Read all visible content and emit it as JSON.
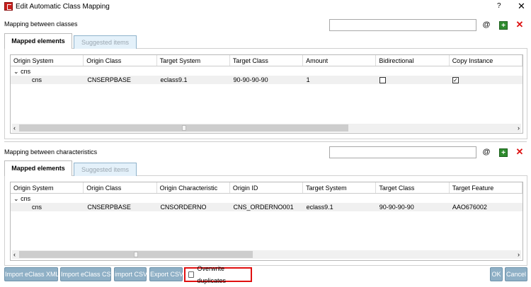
{
  "window": {
    "title": "Edit Automatic Class Mapping",
    "help": "?",
    "close": "✕"
  },
  "classes": {
    "label": "Mapping between classes",
    "search_value": "",
    "tabs": [
      {
        "label": "Mapped elements"
      },
      {
        "label": "Suggested items"
      }
    ],
    "columns": [
      "Origin System",
      "Origin Class",
      "Target System",
      "Target Class",
      "Amount",
      "Bidirectional",
      "Copy Instance"
    ],
    "group": "cns",
    "rows": [
      {
        "origin_system": "cns",
        "origin_class": "CNSERPBASE",
        "target_system": "eclass9.1",
        "target_class": "90-90-90-90",
        "amount": "1",
        "bidirectional": false,
        "copy_instance": true
      }
    ]
  },
  "characteristics": {
    "label": "Mapping between characteristics",
    "search_value": "",
    "tabs": [
      {
        "label": "Mapped elements"
      },
      {
        "label": "Suggested items"
      }
    ],
    "columns": [
      "Origin System",
      "Origin Class",
      "Origin Characteristic",
      "Origin ID",
      "Target System",
      "Target Class",
      "Target Feature"
    ],
    "group": "cns",
    "rows": [
      {
        "origin_system": "cns",
        "origin_class": "CNSERPBASE",
        "origin_characteristic": "CNSORDERNO",
        "origin_id": "CNS_ORDERNO001",
        "target_system": "eclass9.1",
        "target_class": "90-90-90-90",
        "target_feature": "AAO676002"
      }
    ]
  },
  "footer": {
    "import_xml": "Import eClass XML",
    "import_eclass_csv": "Import eClass CSV",
    "import_csv": "import CSV",
    "export_csv": "Export CSV",
    "overwrite_label": "Overwrite duplicates",
    "overwrite_checked": false,
    "ok": "OK",
    "cancel": "Cancel"
  },
  "colors": {
    "accent_button": "#8fb0c6",
    "highlight": "#e01010",
    "delete": "#dd1111"
  }
}
